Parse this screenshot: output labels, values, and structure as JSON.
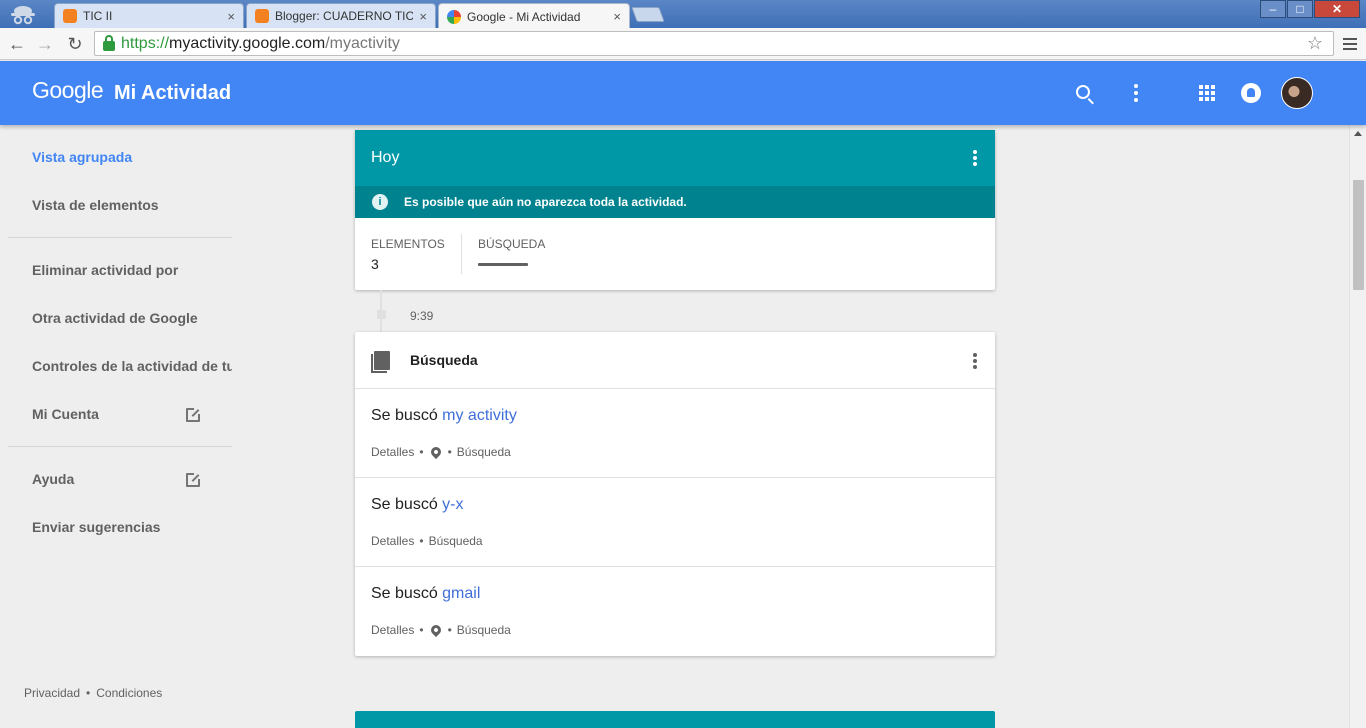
{
  "browser": {
    "tabs": [
      {
        "title": "TIC II",
        "favicon_color": "#f4811f"
      },
      {
        "title": "Blogger: CUADERNO TIC I",
        "favicon_color": "#f4811f"
      },
      {
        "title": "Google - Mi Actividad",
        "favicon_color": "#4285f4"
      }
    ],
    "close_glyph": "×",
    "nav": {
      "back": "←",
      "forward": "→",
      "reload": "↻"
    },
    "url": {
      "scheme": "https://",
      "host": "myactivity.google.com",
      "path": "/myactivity"
    },
    "window_controls": {
      "minimize": "–",
      "maximize": "□",
      "close": "✕"
    },
    "star_glyph": "☆"
  },
  "header": {
    "logo": "Google",
    "product": "Mi Actividad",
    "brand_color": "#4285f4",
    "icons": [
      "search-icon",
      "more-vert-icon",
      "apps-icon",
      "notifications-icon",
      "avatar"
    ]
  },
  "sidebar": {
    "items": [
      {
        "label": "Vista agrupada",
        "selected": true
      },
      {
        "label": "Vista de elementos"
      },
      {
        "label": "Eliminar actividad por"
      },
      {
        "label": "Otra actividad de Google"
      },
      {
        "label": "Controles de la actividad de tu cuenta"
      },
      {
        "label": "Mi Cuenta",
        "external": true
      },
      {
        "label": "Ayuda",
        "external": true
      },
      {
        "label": "Enviar sugerencias"
      }
    ],
    "footer": {
      "privacy": "Privacidad",
      "separator": "•",
      "terms": "Condiciones"
    }
  },
  "day_card": {
    "title": "Hoy",
    "header_color": "#0097a7",
    "notice": "Es posible que aún no aparezca toda la actividad.",
    "info_glyph": "i",
    "stats": {
      "items_label": "ELEMENTOS",
      "items_value": "3",
      "search_label": "BÚSQUEDA"
    }
  },
  "timeline": {
    "time": "9:39"
  },
  "bundle": {
    "title": "Búsqueda",
    "entries": [
      {
        "prefix": "Se buscó ",
        "query": "my activity",
        "details": "Detalles",
        "sep": "•",
        "has_location": true,
        "product": "Búsqueda"
      },
      {
        "prefix": "Se buscó ",
        "query": "y-x",
        "details": "Detalles",
        "sep": "•",
        "has_location": false,
        "product": "Búsqueda"
      },
      {
        "prefix": "Se buscó ",
        "query": "gmail",
        "details": "Detalles",
        "sep": "•",
        "has_location": true,
        "product": "Búsqueda"
      }
    ]
  }
}
